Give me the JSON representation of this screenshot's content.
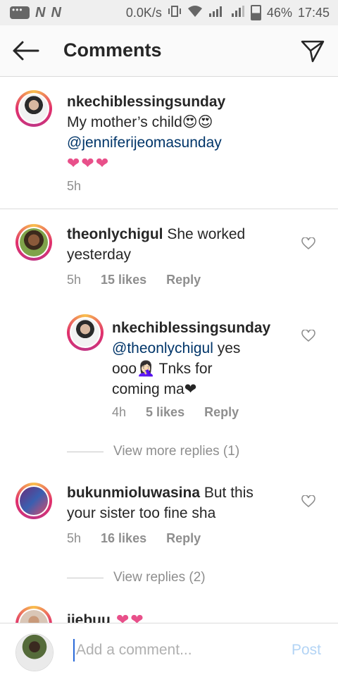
{
  "status_bar": {
    "speed": "0.0K/s",
    "battery": "46%",
    "time": "17:45"
  },
  "header": {
    "title": "Comments"
  },
  "caption": {
    "username": "nkechiblessingsunday",
    "text_line1": "My mother’s child😍😍",
    "mention": "@jenniferijeomasunday",
    "hearts": "❤❤❤",
    "time": "5h"
  },
  "comments": [
    {
      "username": "theonlychigul",
      "text_inline": " She worked",
      "text_line2": "yesterday",
      "time": "5h",
      "likes": "15 likes",
      "reply": "Reply"
    },
    {
      "username": "nkechiblessingsunday",
      "mention": "@theonlychigul",
      "text_inline": " yes",
      "text_line2": "ooo🤦🏻‍♀️ Tnks for",
      "text_line3": "coming ma❤",
      "time": "4h",
      "likes": "5 likes",
      "reply": "Reply"
    },
    {
      "username": "bukunmioluwasina",
      "text_inline": " But this",
      "text_line2": "your sister too fine sha",
      "time": "5h",
      "likes": "16 likes",
      "reply": "Reply"
    },
    {
      "username": "ijebuu",
      "text_inline": " ❤❤"
    }
  ],
  "view_more_replies_1": "View more replies (1)",
  "view_replies_2": "View replies (2)",
  "composer": {
    "placeholder": "Add a comment...",
    "post_label": "Post"
  },
  "colors": {
    "accent_link": "#003569",
    "post_disabled": "#b3d4f5",
    "heart": "#e8508a"
  }
}
